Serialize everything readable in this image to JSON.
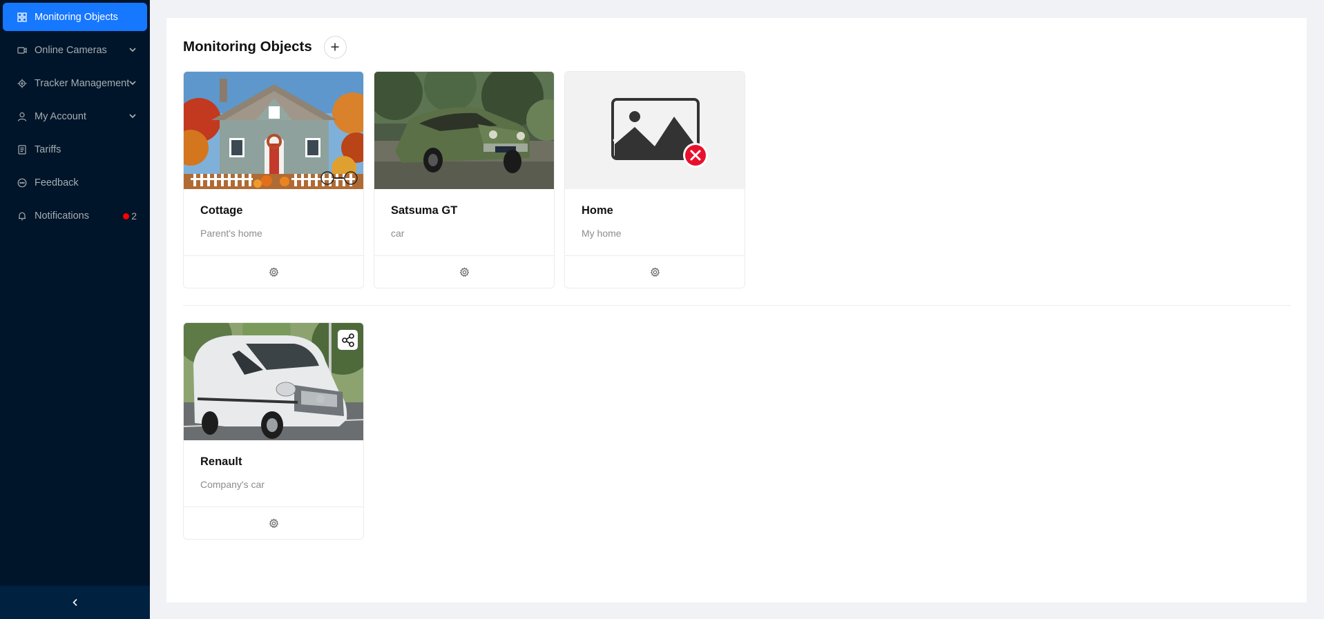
{
  "sidebar": {
    "items": [
      {
        "label": "Monitoring Objects",
        "icon": "grid-icon",
        "active": true
      },
      {
        "label": "Online Cameras",
        "icon": "video-camera-icon",
        "has_submenu": true
      },
      {
        "label": "Tracker Management",
        "icon": "target-icon",
        "has_submenu": true
      },
      {
        "label": "My Account",
        "icon": "user-icon",
        "has_submenu": true
      },
      {
        "label": "Tariffs",
        "icon": "document-icon"
      },
      {
        "label": "Feedback",
        "icon": "chat-icon"
      },
      {
        "label": "Notifications",
        "icon": "bell-icon",
        "badge": "2"
      }
    ],
    "collapse_icon": "chevron-left-icon"
  },
  "colors": {
    "sidebar_bg": "#001529",
    "active_item": "#1677ff",
    "badge_dot": "#ff0000",
    "page_bg": "#f0f2f5"
  },
  "main": {
    "title": "Monitoring Objects",
    "add_icon": "plus-icon",
    "own_objects": [
      {
        "name": "Cottage",
        "description": "Parent's home",
        "image": "cottage-photo"
      },
      {
        "name": "Satsuma GT",
        "description": "car",
        "image": "green-car-photo"
      },
      {
        "name": "Home",
        "description": "My home",
        "image": "broken-image-placeholder"
      }
    ],
    "shared_objects": [
      {
        "name": "Renault",
        "description": "Company's car",
        "image": "white-van-photo",
        "shared": true
      }
    ]
  }
}
